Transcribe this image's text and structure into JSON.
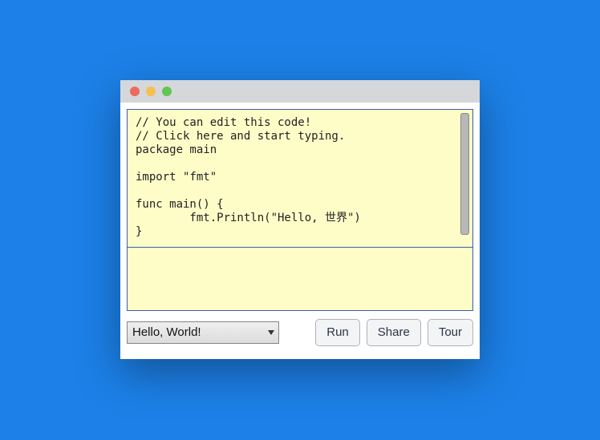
{
  "editor": {
    "code": "// You can edit this code!\n// Click here and start typing.\npackage main\n\nimport \"fmt\"\n\nfunc main() {\n        fmt.Println(\"Hello, 世界\")\n}",
    "output": ""
  },
  "toolbar": {
    "example_selected": "Hello, World!",
    "run_label": "Run",
    "share_label": "Share",
    "tour_label": "Tour"
  },
  "colors": {
    "background": "#1c80e8",
    "editor_bg": "#fefdc8",
    "border": "#375eab"
  }
}
